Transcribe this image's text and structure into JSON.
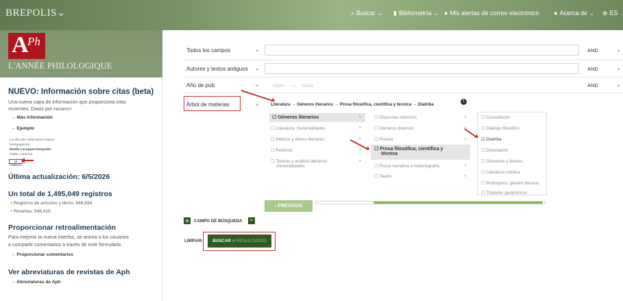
{
  "brand": "BREPOLIS",
  "brand_chevron": "⌄",
  "nav": {
    "buscar": "Buscar",
    "bibliometria": "Bibliometría",
    "alertas": "Mis alertas de correo electrónico",
    "acerca": "Acerca de",
    "lang": "ES"
  },
  "logo": {
    "letter": "A",
    "suffix": "Ph",
    "title": "L'ANNÉE PHILOLOGIQUE"
  },
  "sidebar": {
    "news_title": "NUEVO: Información sobre citas (beta)",
    "news_text_1": "Una nueva capa de información que proporciona citas",
    "news_text_2": "recientes. Datos por",
    "news_source": "PERSPICIT",
    "link_info": "→ Más información",
    "link_example": "→ Ejemplo",
    "mini_1": "La villa des célébrations Equal",
    "mini_2": "bourguignons",
    "mini_3": "Elodie Lecuppre-Desjardin",
    "mini_4": "Gallia. Latomus",
    "citations": "28 Citations",
    "update_title": "Última actualización: 6/5/2026",
    "total_title": "Un total de 1,495,049 registros",
    "bullet_1": "• Registros de artículos y libros: 946,634",
    "bullet_2": "• Reseñas: 548,415",
    "feedback_title": "Proporcionar retroalimentación",
    "feedback_text_1": "Para mejorar la nueva interfaz, se anima a los usuarios",
    "feedback_text_2": "a compartir comentarios a través de este formulario.",
    "feedback_link": "→ Proporcionar comentarios",
    "abbrev_title": "Ver abreviaturas de revistas de Aph",
    "abbrev_link": "→ Abreviaturas de Aph"
  },
  "form": {
    "row1_label": "Todos los campos",
    "row2_label": "Autores y textos antiguos",
    "row3_label": "Año de pub.",
    "row3_from": "AAAA",
    "row3_sep": "—",
    "row3_to": "AAAA",
    "operator": "AND",
    "chev": "⌄",
    "arbol_label": "Árbol de materias",
    "path": "Literatura → Géneros literarios → Prosa filosófica, científica y técnica → Diatriba",
    "info_icon": "!"
  },
  "tree": {
    "col1": [
      "Géneros literarios",
      "☐ Literatura. Generalidades",
      "☐ Métrica y ritmos literarios",
      "☐ Retórica",
      "☐ Teorías y análisis literarios.",
      "Generalidades"
    ],
    "col2": [
      "☐ Discursos retóricos",
      "☐ Géneros diversos",
      "☐ Poesía",
      "☐ Prosa filosófica, científica y",
      "técnica",
      "☐ Prosa narrativa e historiografía",
      "☐ Teatro"
    ],
    "col3": [
      "☐ Consolación",
      "☐ Diálogo filosófico",
      "☑ Diatriba",
      "☐ Disertación",
      "☐ Glosarios y léxicos",
      "☐ Literatura médica",
      "☐ Protréptico, género literario",
      "☐ Tratados geopónicos"
    ],
    "arrow": "›"
  },
  "buttons": {
    "previous": "‹  PREVIOUS",
    "progress_fraction": 0.74,
    "plus": "+",
    "minus": "−",
    "campo": "CAMPO DE BÚSQUEDA",
    "limpiar": "LIMPIAR",
    "buscar": "BUSCAR",
    "buscar_sub": "(4 RESULTADOS)"
  }
}
